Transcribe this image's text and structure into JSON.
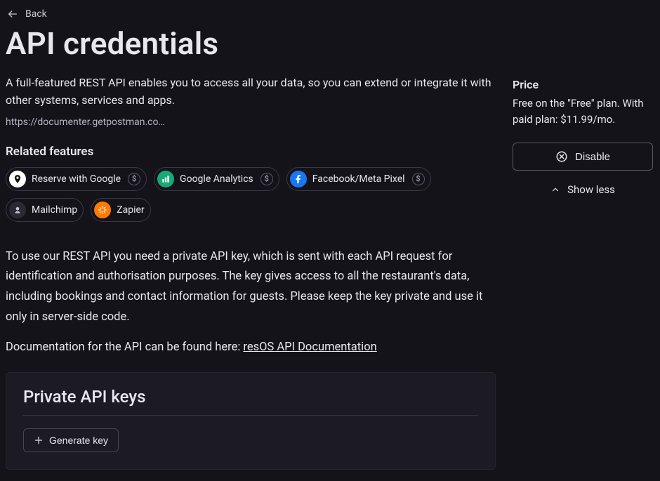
{
  "back_label": "Back",
  "title": "API credentials",
  "description": "A full-featured REST API enables you to access all your data, so you can extend or integrate it with other systems, services and apps.",
  "doc_url_truncated": "https://documenter.getpostman.co…",
  "related": {
    "heading": "Related features",
    "items": [
      {
        "label": "Reserve with Google",
        "has_price": true
      },
      {
        "label": "Google Analytics",
        "has_price": true
      },
      {
        "label": "Facebook/Meta Pixel",
        "has_price": true
      },
      {
        "label": "Mailchimp",
        "has_price": false
      },
      {
        "label": "Zapier",
        "has_price": false
      }
    ]
  },
  "body": {
    "p1": "To use our REST API you need a private API key, which is sent with each API request for identification and authorisation purposes. The key gives access to all the restaurant's data, including bookings and contact information for guests. Please keep the key private and use it only in server-side code.",
    "p2_prefix": "Documentation for the API can be found here: ",
    "p2_link": "resOS API Documentation"
  },
  "keys_panel": {
    "heading": "Private API keys",
    "generate_label": "Generate key"
  },
  "sidebar": {
    "price_heading": "Price",
    "price_text": "Free on the \"Free\" plan. With paid plan: $11.99/mo.",
    "disable_label": "Disable",
    "show_less_label": "Show less"
  },
  "coin_symbol": "$"
}
